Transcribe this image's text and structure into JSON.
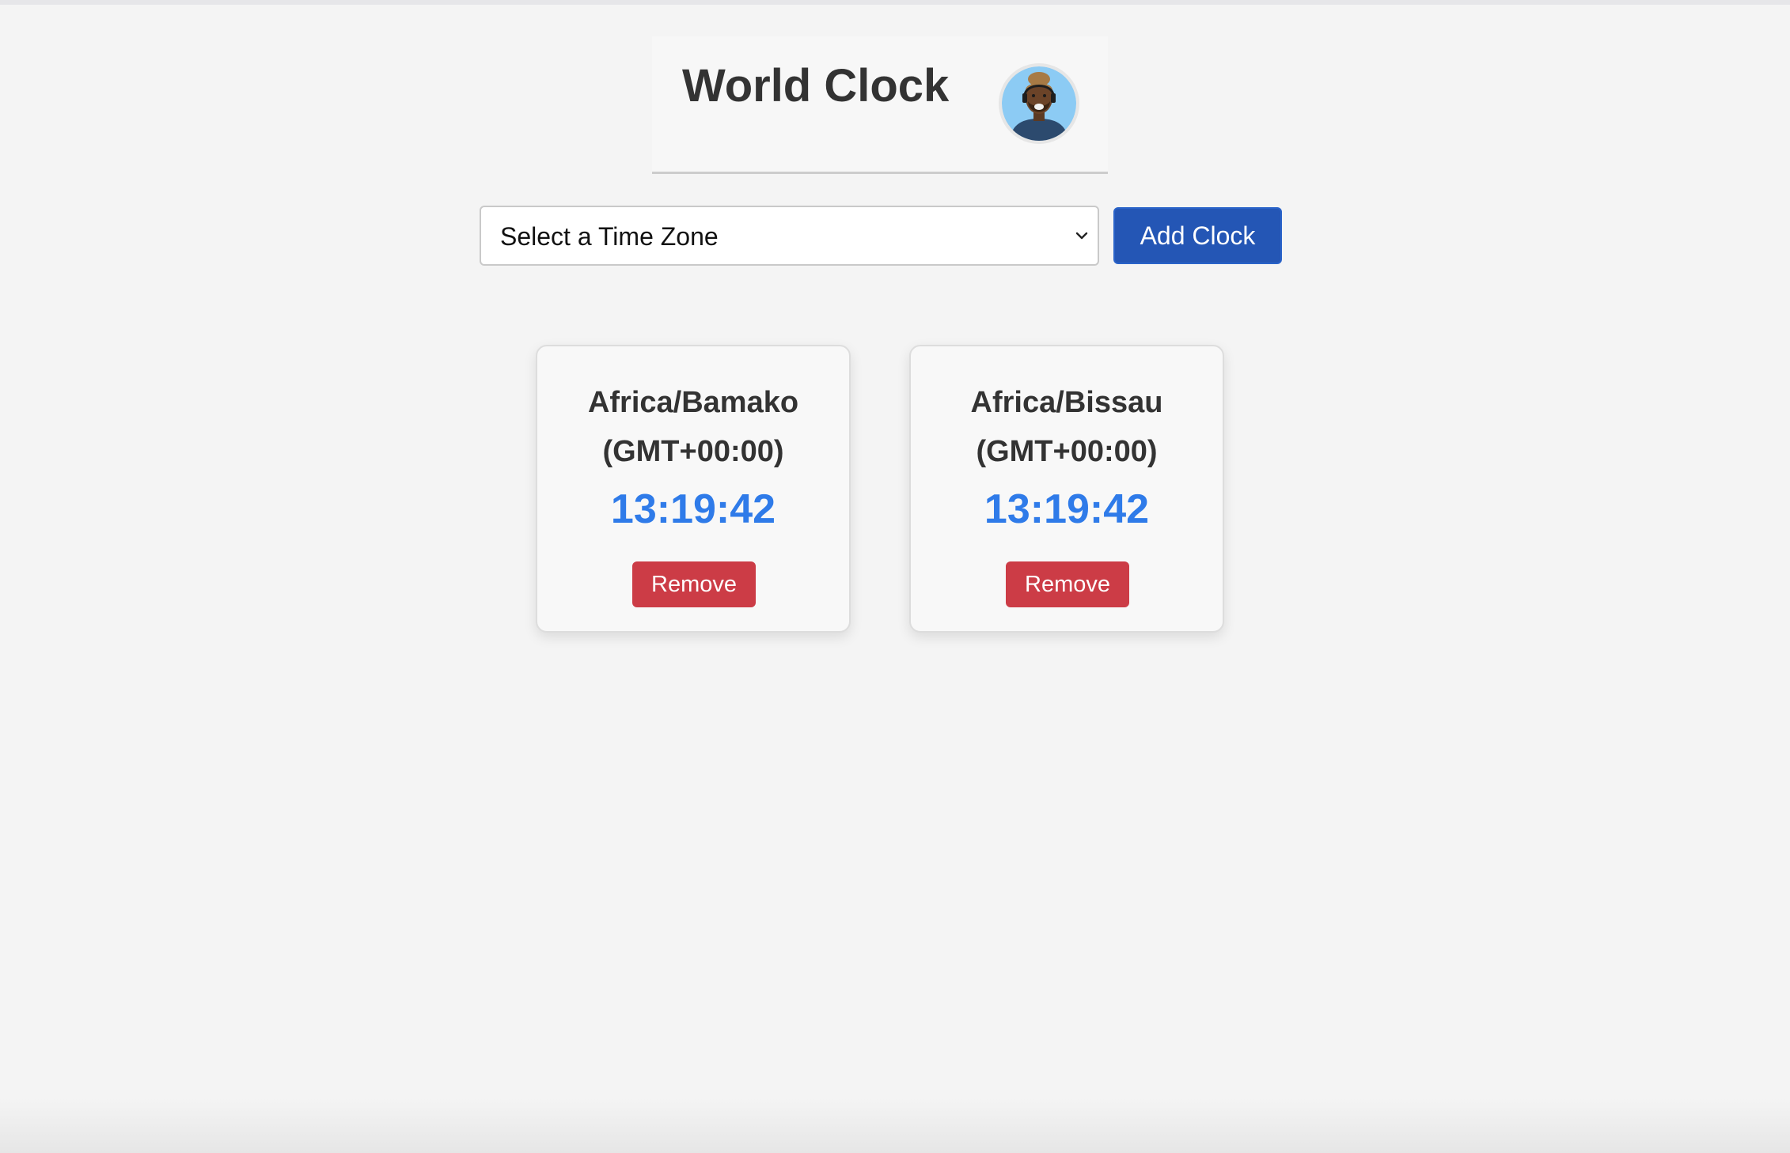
{
  "header": {
    "title": "World Clock",
    "avatar_icon": "user-avatar-icon"
  },
  "controls": {
    "select": {
      "selected": "Select a Time Zone",
      "icon": "chevron-down-icon"
    },
    "add_button_label": "Add Clock"
  },
  "clocks": [
    {
      "zone": "Africa/Bamako",
      "offset": "(GMT+00:00)",
      "time": "13:19:42",
      "remove_label": "Remove"
    },
    {
      "zone": "Africa/Bissau",
      "offset": "(GMT+00:00)",
      "time": "13:19:42",
      "remove_label": "Remove"
    }
  ],
  "colors": {
    "background": "#f4f4f4",
    "accent": "#2456b5",
    "time_text": "#2f7be9",
    "danger": "#cc3c46"
  }
}
